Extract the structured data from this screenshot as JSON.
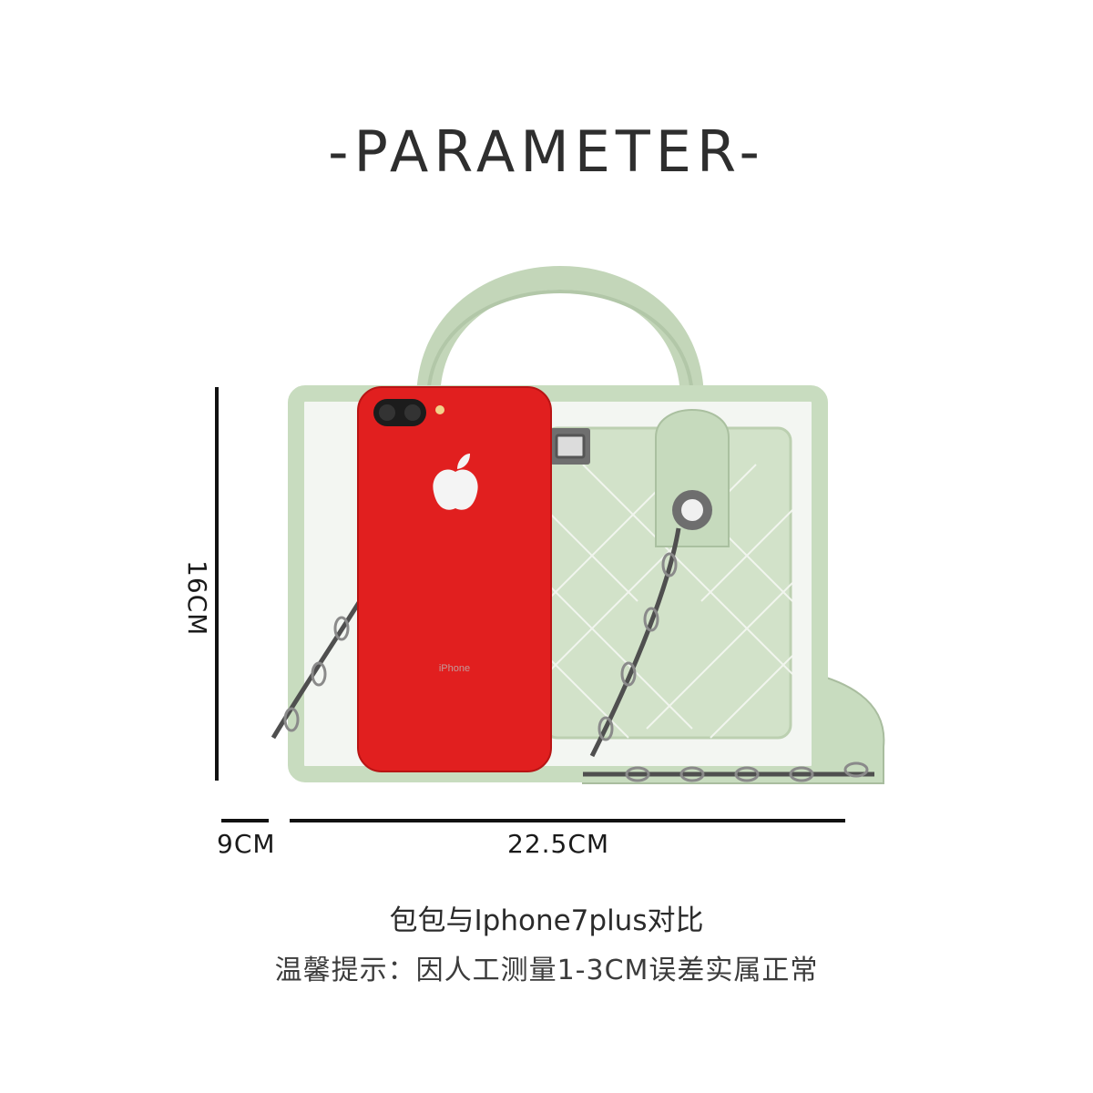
{
  "title": "-PARAMETER-",
  "dimensions": {
    "height_label": "16CM",
    "depth_label": "9CM",
    "width_label": "22.5CM"
  },
  "product": {
    "phone_brand_text": "iPhone"
  },
  "captions": {
    "comparison": "包包与Iphone7plus对比",
    "note": "温馨提示：因人工测量1-3CM误差实属正常"
  },
  "colors": {
    "background": "#ffffff",
    "bag_green": "#c9dcc0",
    "phone_red": "#e0201f"
  }
}
